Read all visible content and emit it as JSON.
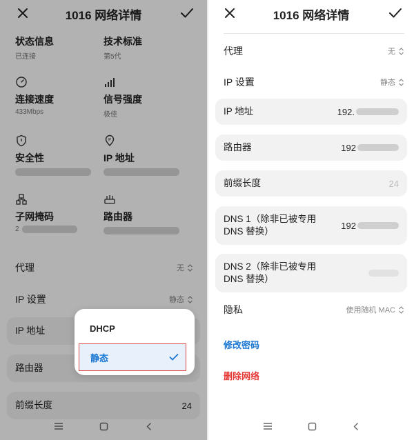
{
  "left": {
    "title": "1016 网络详情",
    "grid": [
      {
        "title": "状态信息",
        "sub": "已连接",
        "icon": "status-icon"
      },
      {
        "title": "技术标准",
        "sub": "第5代",
        "icon": "wifi-standard-icon"
      },
      {
        "title": "连接速度",
        "sub": "433Mbps",
        "icon": "speed-gauge-icon"
      },
      {
        "title": "信号强度",
        "sub": "极佳",
        "icon": "signal-bars-icon"
      },
      {
        "title": "安全性",
        "sub": "",
        "icon": "shield-icon"
      },
      {
        "title": "IP 地址",
        "sub": "",
        "icon": "ip-pin-icon"
      },
      {
        "title": "子网掩码",
        "sub": "2",
        "icon": "subnet-icon"
      },
      {
        "title": "路由器",
        "sub": "",
        "icon": "router-icon"
      }
    ],
    "proxy": {
      "label": "代理",
      "value": "无"
    },
    "ip_settings": {
      "label": "IP 设置",
      "value": "静态"
    },
    "cards": [
      {
        "label": "IP 地址",
        "value": ""
      },
      {
        "label": "路由器",
        "value": ""
      },
      {
        "label": "前缀长度",
        "value": "24"
      }
    ],
    "dropdown": {
      "options": [
        "DHCP",
        "静态"
      ],
      "selected": "静态"
    }
  },
  "right": {
    "title": "1016 网络详情",
    "proxy": {
      "label": "代理",
      "value": "无"
    },
    "ip_settings": {
      "label": "IP 设置",
      "value": "静态"
    },
    "cards": [
      {
        "label": "IP 地址",
        "value": "192."
      },
      {
        "label": "路由器",
        "value": "192"
      },
      {
        "label": "前缀长度",
        "value": "24"
      },
      {
        "label_l1": "DNS 1（除非已被专用",
        "label_l2": "DNS 替换）",
        "value": "192"
      },
      {
        "label_l1": "DNS 2（除非已被专用",
        "label_l2": "DNS 替换）",
        "value": ""
      }
    ],
    "privacy": {
      "label": "隐私",
      "value": "使用随机 MAC"
    },
    "change_password": "修改密码",
    "delete_network": "删除网络"
  },
  "colors": {
    "accent": "#1976d2",
    "danger": "#e53935",
    "card_bg": "#f2f2f2",
    "selected_bg": "#e8f1fb",
    "highlight_border": "#e04848"
  }
}
